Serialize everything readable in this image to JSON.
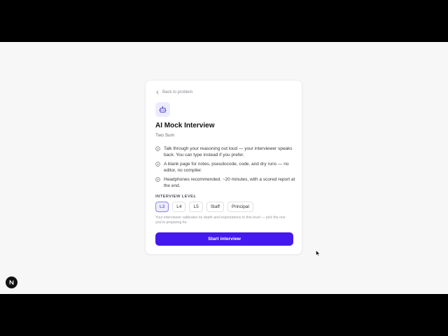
{
  "back_link": {
    "label": "Back to problem",
    "icon": "chevron-left-icon"
  },
  "header": {
    "icon": "bot-icon",
    "title": "AI Mock Interview",
    "subtitle": "Two Sum"
  },
  "features": [
    {
      "icon": "check-circle-icon",
      "text": "Talk through your reasoning out loud — your interviewer speaks back. You can type instead if you prefer."
    },
    {
      "icon": "check-circle-icon",
      "text": "A blank page for notes, pseudocode, code, and dry runs — no editor, no compiler."
    },
    {
      "icon": "check-circle-icon",
      "text": "Headphones recommended. ~20 minutes, with a scored report at the end."
    }
  ],
  "level": {
    "label": "INTERVIEW LEVEL",
    "options": [
      "L3",
      "L4",
      "L5",
      "Staff",
      "Principal"
    ],
    "selected": "L3",
    "hint": "Your interviewer calibrates its depth and expectations to this level — pick the one you're preparing for."
  },
  "start_button": {
    "label": "Start interview"
  },
  "colors": {
    "accent": "#4419ec",
    "accent_soft": "#ececfd",
    "background": "#f7f7f8"
  }
}
